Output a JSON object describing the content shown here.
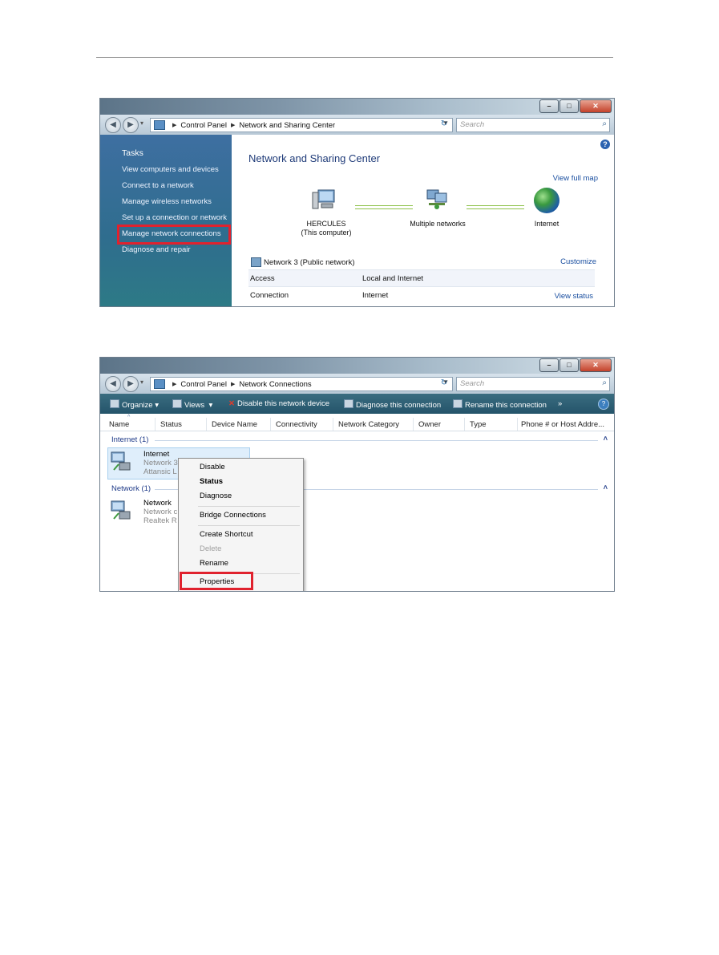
{
  "window1": {
    "address": {
      "crumb1": "Control Panel",
      "crumb2": "Network and Sharing Center"
    },
    "search_placeholder": "Search",
    "sidebar": {
      "heading": "Tasks",
      "items": [
        "View computers and devices",
        "Connect to a network",
        "Manage wireless networks",
        "Set up a connection or network",
        "Manage network connections",
        "Diagnose and repair"
      ],
      "highlighted": "Manage network connections"
    },
    "main": {
      "title": "Network and Sharing Center",
      "view_full_map": "View full map",
      "nodes": {
        "computer_name": "HERCULES",
        "computer_sub": "(This computer)",
        "networks": "Multiple networks",
        "internet": "Internet"
      },
      "network_name": "Network 3 (Public network)",
      "customize": "Customize",
      "rows": [
        {
          "label": "Access",
          "value": "Local and Internet",
          "link": ""
        },
        {
          "label": "Connection",
          "value": "Internet",
          "link": "View status"
        }
      ]
    }
  },
  "window2": {
    "address": {
      "crumb1": "Control Panel",
      "crumb2": "Network Connections"
    },
    "search_placeholder": "Search",
    "toolbar": {
      "organize": "Organize",
      "views": "Views",
      "disable": "Disable this network device",
      "diagnose": "Diagnose this connection",
      "rename": "Rename this connection",
      "more": "»"
    },
    "columns": [
      "Name",
      "Status",
      "Device Name",
      "Connectivity",
      "Network Category",
      "Owner",
      "Type",
      "Phone # or Host Addre..."
    ],
    "groups": [
      {
        "title": "Internet (1)",
        "item": {
          "name": "Internet",
          "line2": "Network 3",
          "line3": "Attansic L"
        }
      },
      {
        "title": "Network (1)",
        "item": {
          "name": "Network",
          "line2": "Network c",
          "line3": "Realtek R"
        }
      }
    ],
    "context_menu": [
      "Disable",
      "Status",
      "Diagnose",
      "Bridge Connections",
      "Create Shortcut",
      "Delete",
      "Rename",
      "Properties"
    ],
    "highlighted_menu_item": "Properties"
  }
}
